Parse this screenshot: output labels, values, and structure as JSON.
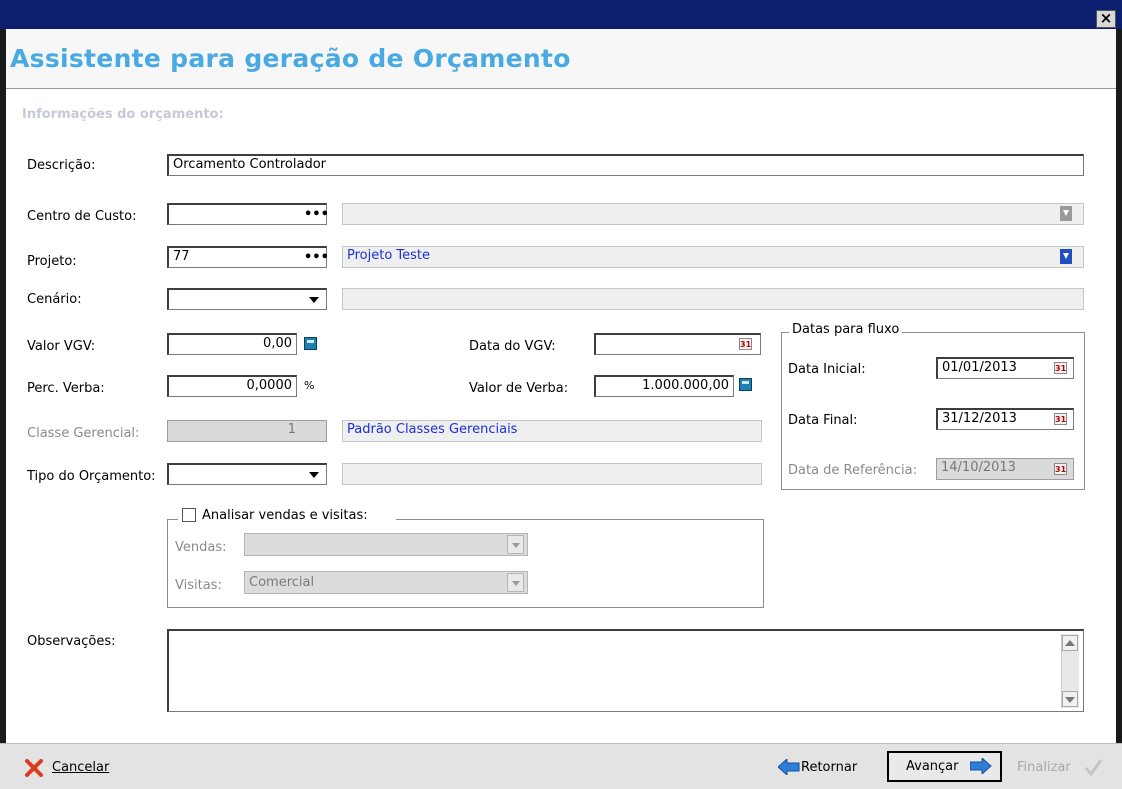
{
  "window": {
    "close_symbol": "×"
  },
  "title": "Assistente para geração de Orçamento",
  "section_title": "Informações do orçamento:",
  "form": {
    "descricao": {
      "label": "Descrição:",
      "value": "Orcamento Controlador"
    },
    "centro_custo": {
      "label": "Centro de Custo:",
      "code": "",
      "name": "",
      "lookup_button": "•••"
    },
    "projeto": {
      "label": "Projeto:",
      "code": "77",
      "name": "Projeto Teste",
      "lookup_button": "•••"
    },
    "cenario": {
      "label": "Cenário:",
      "value": "",
      "desc": ""
    },
    "valor_vgv": {
      "label": "Valor VGV:",
      "value": "0,00"
    },
    "data_vgv": {
      "label": "Data do VGV:",
      "value": ""
    },
    "perc_verba": {
      "label": "Perc. Verba:",
      "value": "0,0000",
      "unit": "%"
    },
    "valor_verba": {
      "label": "Valor de Verba:",
      "value": "1.000.000,00"
    },
    "classe_gerencial": {
      "label": "Classe Gerencial:",
      "value": "1",
      "name": "Padrão Classes Gerenciais"
    },
    "tipo_orcamento": {
      "label": "Tipo do Orçamento:",
      "value": "",
      "desc": ""
    }
  },
  "datas_fluxo": {
    "title": "Datas para fluxo",
    "data_inicial": {
      "label": "Data Inicial:",
      "value": "01/01/2013"
    },
    "data_final": {
      "label": "Data Final:",
      "value": "31/12/2013"
    },
    "data_referencia": {
      "label": "Data de Referência:",
      "value": "14/10/2013"
    }
  },
  "analisar": {
    "title": "Analisar vendas e visitas:",
    "checked": false,
    "vendas": {
      "label": "Vendas:",
      "value": ""
    },
    "visitas": {
      "label": "Visitas:",
      "value": "Comercial"
    }
  },
  "observacoes": {
    "label": "Observações:",
    "value": ""
  },
  "buttons": {
    "cancelar": "Cancelar",
    "retornar": "Retornar",
    "avancar": "Avançar",
    "finalizar": "Finalizar"
  },
  "icons": [
    "close-icon",
    "ellipsis-icon",
    "dropdown-arrow-icon",
    "calculator-icon",
    "calendar-icon",
    "percent-icon",
    "download-icon",
    "cancel-x-icon",
    "back-arrow-icon",
    "forward-arrow-icon",
    "check-icon"
  ]
}
